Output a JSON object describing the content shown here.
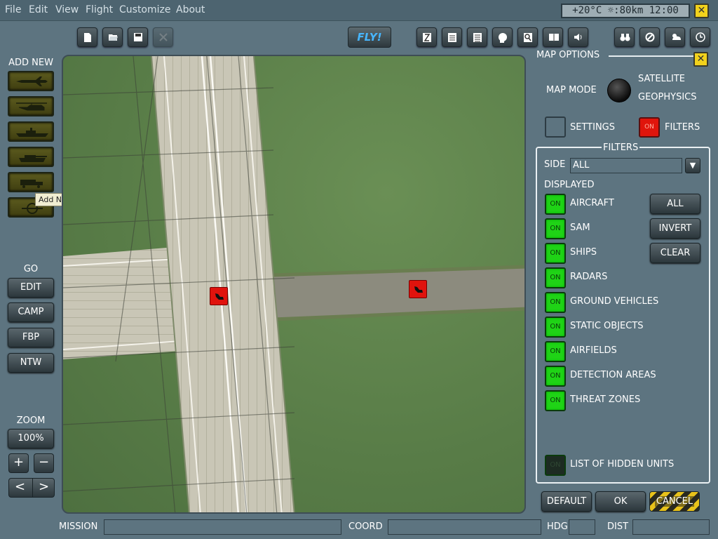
{
  "menu": [
    "File",
    "Edit",
    "View",
    "Flight",
    "Customize",
    "About"
  ],
  "weather_readout": "+20°C ☼:80km 12:00",
  "toolbar": {
    "fly_label": "FLY!",
    "left_icons": [
      "new-document-icon",
      "open-folder-icon",
      "save-icon",
      "close-mission-icon"
    ],
    "right_icons": [
      "time-icon",
      "briefing-icon",
      "checklist-icon",
      "pilot-head-icon",
      "zoom-search-icon",
      "encyclopedia-icon",
      "sound-icon",
      "binoculars-icon",
      "no-entry-icon",
      "weather-icon",
      "clock-icon"
    ]
  },
  "left_panel": {
    "add_new_label": "ADD NEW",
    "add_new_items": [
      "aircraft-icon",
      "helicopter-icon",
      "ship-icon",
      "tank-icon",
      "static-object-icon",
      "airfield-icon"
    ],
    "tooltip": "Add New Static Object",
    "go_label": "GO",
    "go_buttons": [
      "EDIT",
      "CAMP",
      "FBP",
      "NTW"
    ],
    "zoom_label": "ZOOM",
    "zoom_value": "100%",
    "zoom_in": "+",
    "zoom_out": "−",
    "nav_prev": "<",
    "nav_next": ">"
  },
  "map_options": {
    "title": "MAP OPTIONS",
    "map_mode_label": "MAP MODE",
    "mode_satellite": "SATELLITE",
    "mode_geophysics": "GEOPHYSICS",
    "settings_label": "SETTINGS",
    "filters_label": "FILTERS",
    "filters_toggle": "ON",
    "filters_title": "FILTERS",
    "side_label": "SIDE",
    "side_value": "ALL",
    "displayed_label": "DISPLAYED",
    "filters": [
      {
        "label": "AIRCRAFT",
        "state": "ON"
      },
      {
        "label": "SAM",
        "state": "ON"
      },
      {
        "label": "SHIPS",
        "state": "ON"
      },
      {
        "label": "RADARS",
        "state": "ON"
      },
      {
        "label": "GROUND VEHICLES",
        "state": "ON"
      },
      {
        "label": "STATIC OBJECTS",
        "state": "ON"
      },
      {
        "label": "AIRFIELDS",
        "state": "ON"
      },
      {
        "label": "DETECTION AREAS",
        "state": "ON"
      },
      {
        "label": "THREAT ZONES",
        "state": "ON"
      }
    ],
    "btn_all": "ALL",
    "btn_invert": "INVERT",
    "btn_clear": "CLEAR",
    "hidden_units_label": "LIST OF HIDDEN UNITS",
    "hidden_units_toggle": "ON",
    "btn_default": "DEFAULT",
    "btn_ok": "OK",
    "btn_cancel": "CANCEL"
  },
  "status_bar": {
    "mission_label": "MISSION",
    "coord_label": "COORD",
    "hdg_label": "HDG",
    "dist_label": "DIST"
  },
  "colors": {
    "background": "#5d7480",
    "unit_red": "#e0130d",
    "toggle_green": "#1fd316",
    "close_yellow": "#f2d21c",
    "fly_blue": "#47b6ff"
  }
}
